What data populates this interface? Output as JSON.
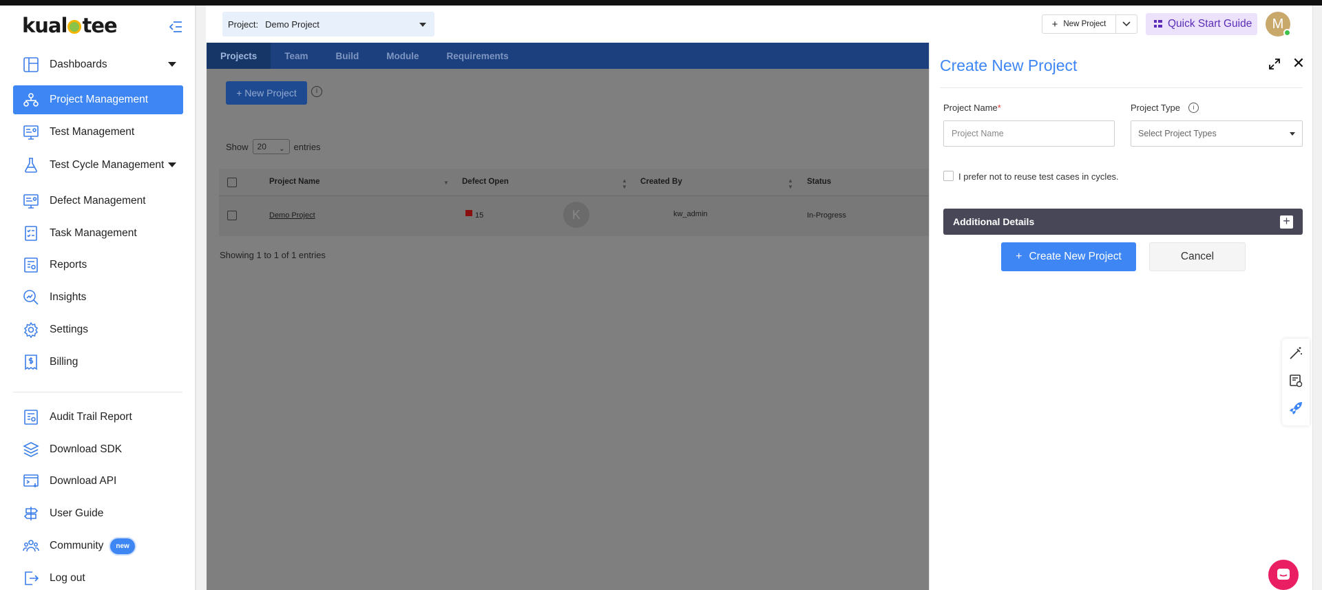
{
  "brand": {
    "logo_left": "kual",
    "logo_right": "tee"
  },
  "sidebar": {
    "items": [
      {
        "label": "Dashboards"
      },
      {
        "label": "Project Management"
      },
      {
        "label": "Test Management"
      },
      {
        "label": "Test Cycle Management"
      },
      {
        "label": "Defect Management"
      },
      {
        "label": "Task Management"
      },
      {
        "label": "Reports"
      },
      {
        "label": "Insights"
      },
      {
        "label": "Settings"
      },
      {
        "label": "Billing"
      },
      {
        "label": "Audit Trail Report"
      },
      {
        "label": "Download SDK"
      },
      {
        "label": "Download API"
      },
      {
        "label": "User Guide"
      },
      {
        "label": "Community",
        "badge": "new"
      },
      {
        "label": "Log out"
      }
    ]
  },
  "header": {
    "project_label": "Project:",
    "project_value": "Demo Project",
    "new_project_label": "New Project",
    "quick_start_label": "Quick Start Guide",
    "avatar_initial": "M"
  },
  "main": {
    "tabs": [
      {
        "label": "Projects"
      },
      {
        "label": "Team"
      },
      {
        "label": "Build"
      },
      {
        "label": "Module"
      },
      {
        "label": "Requirements"
      }
    ],
    "new_project_btn": "+ New Project",
    "info": "i",
    "show_label": "Show",
    "entries_value": "20",
    "entries_label": "entries",
    "table": {
      "columns": [
        "Project Name",
        "Defect Open",
        "Created By",
        "Status"
      ],
      "rows": [
        {
          "project_name": "Demo Project",
          "defect_open": "15",
          "created_by_initial": "K",
          "created_by": "kw_admin",
          "status": "In-Progress"
        }
      ]
    },
    "showing": "Showing 1 to 1 of 1 entries"
  },
  "drawer": {
    "title": "Create New Project",
    "project_name_label": "Project Name",
    "required_mark": "*",
    "project_name_placeholder": "Project Name",
    "project_type_label": "Project Type",
    "project_type_placeholder": "Select Project Types",
    "reuse_label": "I prefer not to reuse test cases in cycles.",
    "additional_details": "Additional Details",
    "create_btn": "Create New Project",
    "cancel_btn": "Cancel"
  },
  "colors": {
    "accent": "#3d86f4",
    "quick_start_bg": "#ece2fb",
    "additional_bar": "#474758",
    "chat": "#e91e63"
  }
}
